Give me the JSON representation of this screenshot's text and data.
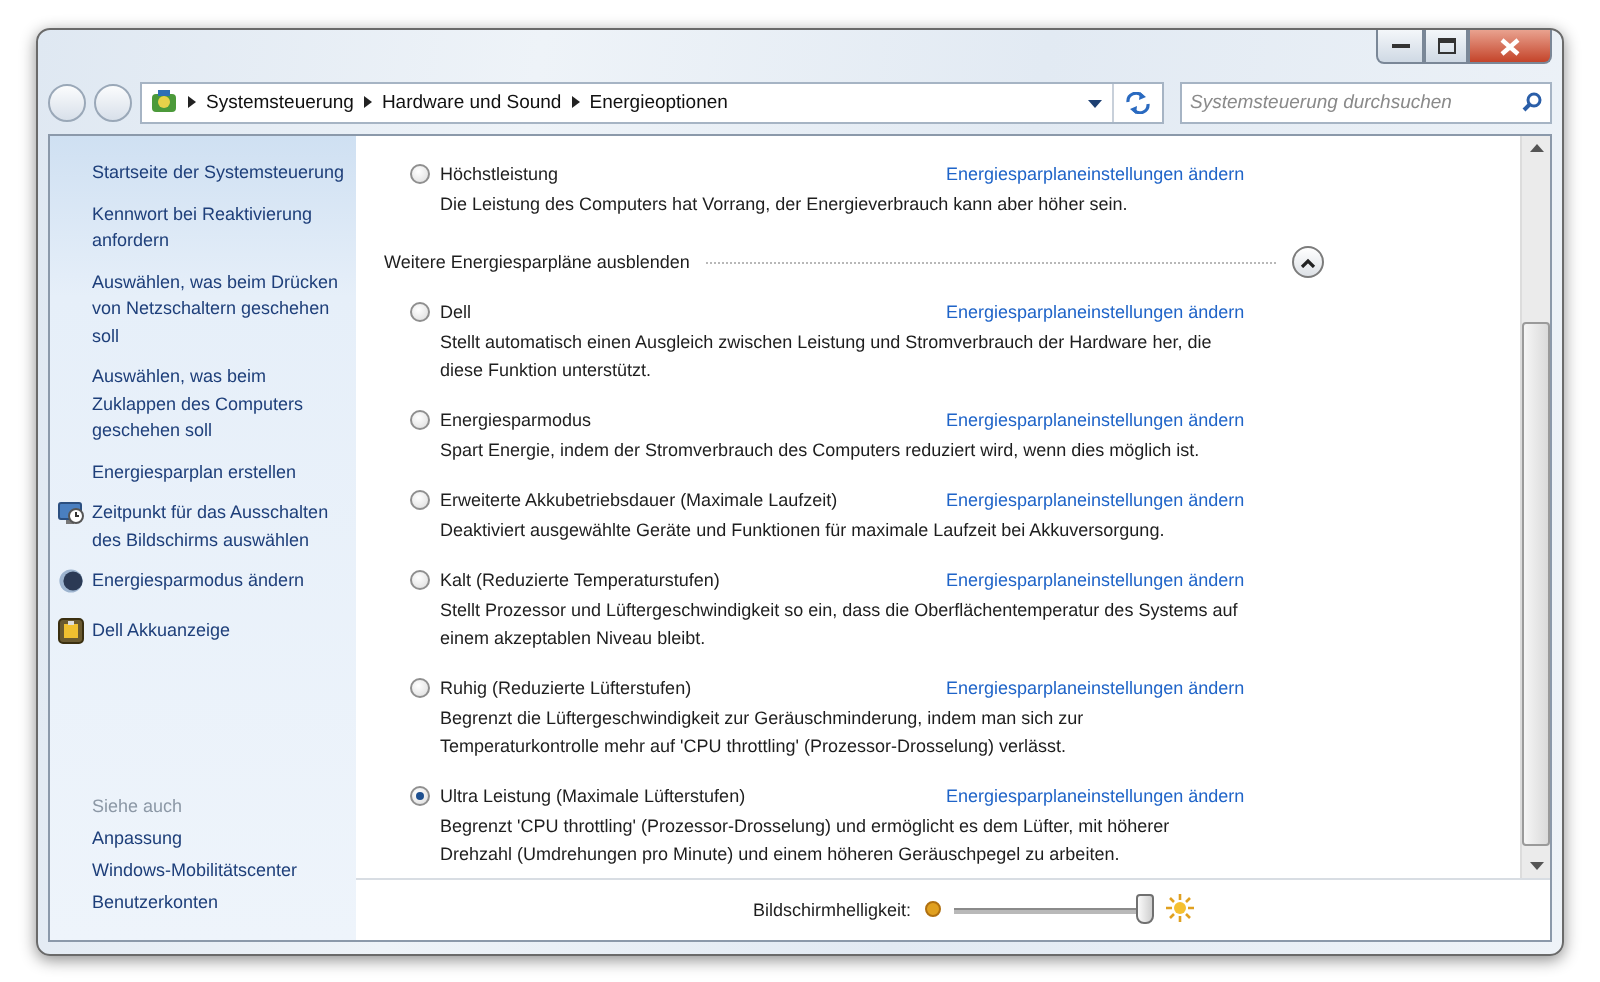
{
  "address_bar": {
    "crumbs": [
      "Systemsteuerung",
      "Hardware und Sound",
      "Energieoptionen"
    ]
  },
  "search": {
    "placeholder": "Systemsteuerung durchsuchen"
  },
  "sidebar": {
    "items": [
      {
        "kind": "link",
        "label": "Startseite der Systemsteuerung"
      },
      {
        "kind": "link",
        "label": "Kennwort bei Reaktivierung anfordern"
      },
      {
        "kind": "link",
        "label": "Auswählen, was beim Drücken von Netzschaltern geschehen soll"
      },
      {
        "kind": "link",
        "label": "Auswählen, was beim Zuklappen des Computers geschehen soll"
      },
      {
        "kind": "link",
        "label": "Energiesparplan erstellen"
      },
      {
        "kind": "icon_link",
        "label": "Zeitpunkt für das Ausschalten des Bildschirms auswählen"
      },
      {
        "kind": "icon_link",
        "label": "Energiesparmodus ändern"
      },
      {
        "kind": "icon_link",
        "label": "Dell Akkuanzeige"
      }
    ],
    "see_also": {
      "heading": "Siehe auch",
      "items": [
        "Anpassung",
        "Windows-Mobilitätscenter",
        "Benutzerkonten"
      ]
    }
  },
  "plans": [
    {
      "name": "Höchstleistung",
      "selected": false,
      "link": "Energiesparplaneinstellungen ändern",
      "description": "Die Leistung des Computers hat Vorrang, der Energieverbrauch kann aber höher sein."
    }
  ],
  "more_plans": {
    "label": "Weitere Energiesparpläne ausblenden",
    "expanded": true,
    "plans": [
      {
        "name": "Dell",
        "selected": false,
        "link": "Energiesparplaneinstellungen ändern",
        "description": "Stellt automatisch einen Ausgleich zwischen Leistung und Stromverbrauch der Hardware her, die diese Funktion unterstützt."
      },
      {
        "name": "Energiesparmodus",
        "selected": false,
        "link": "Energiesparplaneinstellungen ändern",
        "description": "Spart Energie, indem der Stromverbrauch des Computers reduziert wird, wenn dies möglich ist."
      },
      {
        "name": "Erweiterte Akkubetriebsdauer (Maximale Laufzeit)",
        "selected": false,
        "link": "Energiesparplaneinstellungen ändern",
        "description": "Deaktiviert ausgewählte Geräte und Funktionen für maximale Laufzeit bei Akkuversorgung."
      },
      {
        "name": "Kalt (Reduzierte Temperaturstufen)",
        "selected": false,
        "link": "Energiesparplaneinstellungen ändern",
        "description": "Stellt Prozessor und Lüftergeschwindigkeit so ein, dass die Oberflächentemperatur des Systems auf einem akzeptablen Niveau bleibt."
      },
      {
        "name": "Ruhig (Reduzierte Lüfterstufen)",
        "selected": false,
        "link": "Energiesparplaneinstellungen ändern",
        "description": "Begrenzt die Lüftergeschwindigkeit zur Geräuschminderung, indem man sich zur Temperaturkontrolle mehr auf 'CPU throttling' (Prozessor-Drosselung) verlässt."
      },
      {
        "name": "Ultra Leistung (Maximale Lüfterstufen)",
        "selected": true,
        "link": "Energiesparplaneinstellungen ändern",
        "description": "Begrenzt 'CPU throttling' (Prozessor-Drosselung) und ermöglicht es dem Lüfter, mit höherer Drehzahl (Umdrehungen pro Minute) und einem höheren Geräuschpegel zu arbeiten."
      }
    ]
  },
  "brightness": {
    "label": "Bildschirmhelligkeit:",
    "level": 0.95
  }
}
